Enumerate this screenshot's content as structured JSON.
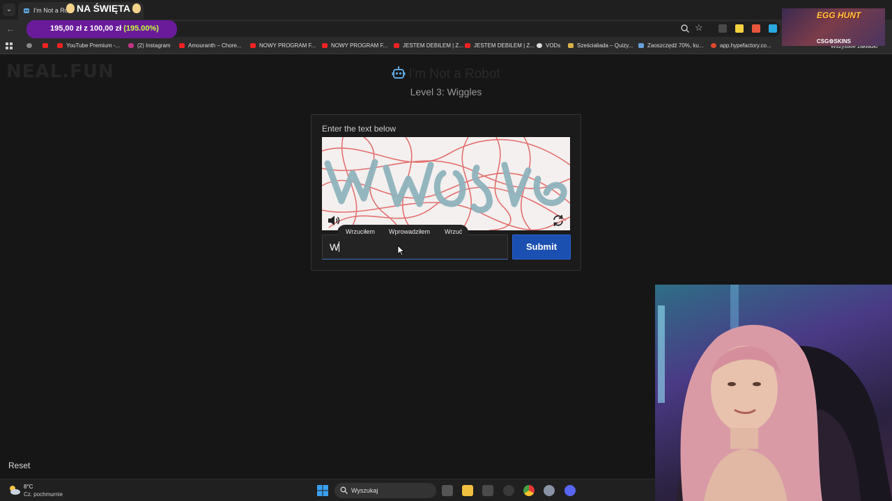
{
  "browser": {
    "tab_title": "I'm Not a Ro",
    "stream_banner": "NA ŚWIĘTA",
    "progress_amount": "195,00 zł",
    "progress_of": "z 100,00 zł",
    "progress_percent": "(195.00%)",
    "bookmarks": [
      "YouTube Premium -...",
      "(2) Instagram",
      "Amouranth – Chore...",
      "NOWY PROGRAM F...",
      "NOWY PROGRAM F...",
      "JESTEM DEBILEM | Z...",
      "JESTEM DEBILEM | Z...",
      "VODs",
      "Sześcialiada – Quizy...",
      "Zaoszczędź 70%, ku...",
      "app.hypefactory.co..."
    ],
    "all_bookmarks": "Wszystkie zakładki"
  },
  "overlay": {
    "top_cam_title": "EGG HUNT",
    "top_cam_brand": "CSG⚙SKINS"
  },
  "page": {
    "logo": "NEAL.FUN",
    "title": "I'm Not a Robot",
    "level": "Level 3: Wiggles",
    "card_label": "Enter the text below",
    "input_value": "W",
    "submit_label": "Submit",
    "suggestions": [
      "Wrzuciłem",
      "Wprowadziłem",
      "Wrzuć"
    ],
    "reset_label": "Reset"
  },
  "taskbar": {
    "weather_temp": "8°C",
    "weather_desc": "Cz. pochmurnie",
    "search_label": "Wyszukaj"
  },
  "colors": {
    "accent": "#1b4fb0",
    "progress_pill": "#6a1b9a",
    "captcha_bg": "#f4f0ef",
    "captcha_text": "#8fb3bd",
    "captcha_noise": "#e05a5a"
  }
}
